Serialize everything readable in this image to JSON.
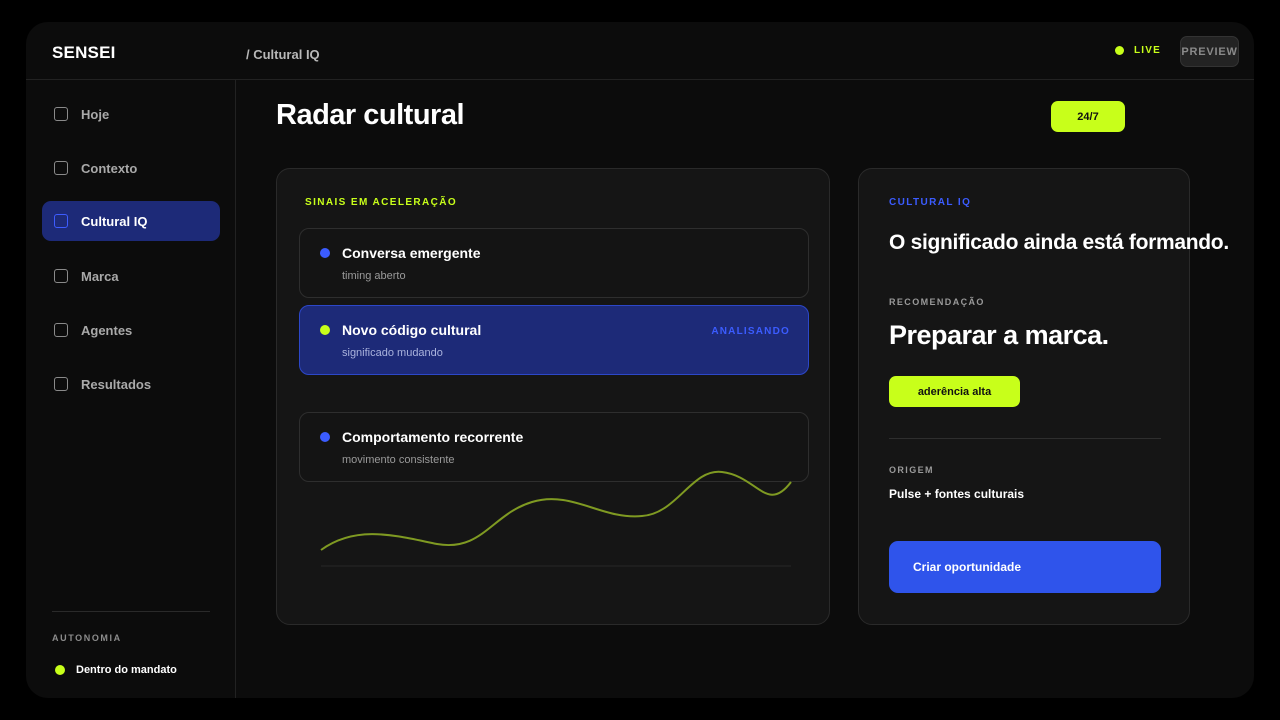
{
  "brand": "SENSEI",
  "breadcrumb": "/ Cultural IQ",
  "header": {
    "live_label": "LIVE",
    "preview_label": "PREVIEW"
  },
  "sidebar": {
    "items": [
      {
        "label": "Hoje",
        "active": false
      },
      {
        "label": "Contexto",
        "active": false
      },
      {
        "label": "Cultural IQ",
        "active": true
      },
      {
        "label": "Marca",
        "active": false
      },
      {
        "label": "Agentes",
        "active": false
      },
      {
        "label": "Resultados",
        "active": false
      }
    ],
    "autonomy_label": "AUTONOMIA",
    "autonomy_status": "Dentro do mandato"
  },
  "main": {
    "title": "Radar cultural",
    "badge": "24/7"
  },
  "signals_panel": {
    "label": "SINAIS EM ACELERAÇÃO",
    "signals": [
      {
        "title": "Conversa emergente",
        "subtitle": "timing aberto",
        "status": ""
      },
      {
        "title": "Novo código cultural",
        "subtitle": "significado mudando",
        "status": "ANALISANDO"
      },
      {
        "title": "Comportamento recorrente",
        "subtitle": "movimento consistente",
        "status": ""
      }
    ]
  },
  "insight_panel": {
    "label": "CULTURAL IQ",
    "headline": "O significado ainda está formando.",
    "recommendation_label": "RECOMENDAÇÃO",
    "recommendation": "Preparar a marca.",
    "fit_badge": "aderência alta",
    "origin_label": "ORIGEM",
    "origin": "Pulse + fontes culturais",
    "cta_label": "Criar oportunidade"
  },
  "colors": {
    "accent_lime": "#c8ff1a",
    "accent_blue": "#3b5cff",
    "active_nav_bg": "#1d2a78",
    "cta_blue": "#2f54eb"
  }
}
